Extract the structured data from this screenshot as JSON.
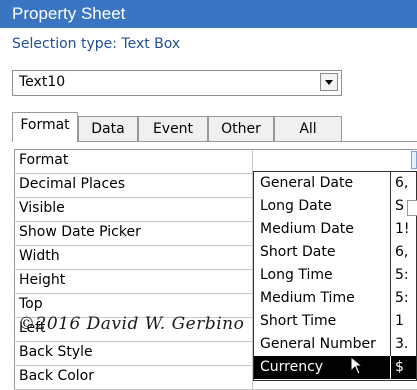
{
  "window": {
    "title": "Property Sheet"
  },
  "selection_type": "Selection type:  Text Box",
  "object_combo": {
    "value": "Text10",
    "button_icon": "chevron-down-icon"
  },
  "tabs": [
    {
      "label": "Format",
      "active": true
    },
    {
      "label": "Data",
      "active": false
    },
    {
      "label": "Event",
      "active": false
    },
    {
      "label": "Other",
      "active": false
    },
    {
      "label": "All",
      "active": false
    }
  ],
  "properties": [
    {
      "name": "Format"
    },
    {
      "name": "Decimal Places"
    },
    {
      "name": "Visible"
    },
    {
      "name": "Show Date Picker"
    },
    {
      "name": "Width"
    },
    {
      "name": "Height"
    },
    {
      "name": "Top"
    },
    {
      "name": "Left"
    },
    {
      "name": "Back Style"
    },
    {
      "name": "Back Color"
    }
  ],
  "format_dropdown": {
    "items": [
      {
        "name": "General Date",
        "sample": "6,"
      },
      {
        "name": "Long Date",
        "sample": "S"
      },
      {
        "name": "Medium Date",
        "sample": "1!"
      },
      {
        "name": "Short Date",
        "sample": "6,"
      },
      {
        "name": "Long Time",
        "sample": "5:"
      },
      {
        "name": "Medium Time",
        "sample": "5:"
      },
      {
        "name": "Short Time",
        "sample": "1"
      },
      {
        "name": "General Number",
        "sample": "3."
      },
      {
        "name": "Currency",
        "sample": "$",
        "selected": true
      }
    ]
  },
  "watermark": "©2016 David W. Gerbino",
  "colors": {
    "titlebar": "#3a75c4",
    "selection_text": "#1f4e9a",
    "selected_row": "#000000"
  }
}
